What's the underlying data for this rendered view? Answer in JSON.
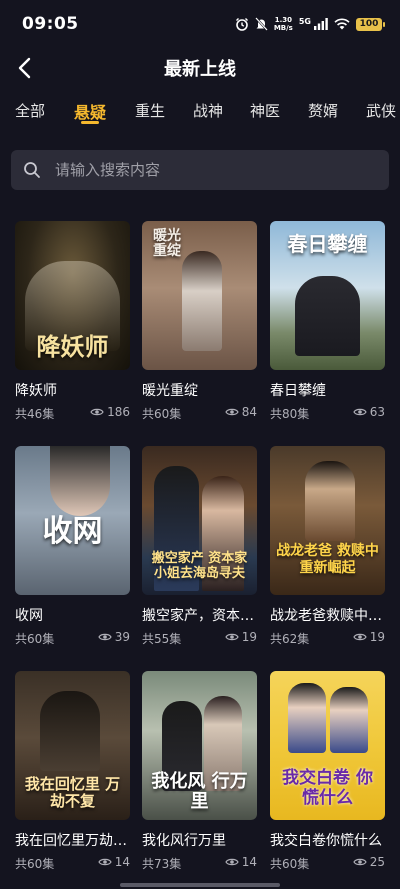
{
  "status": {
    "time": "09:05",
    "net_speed_value": "1.30",
    "net_speed_unit": "MB/s",
    "network": "5G",
    "battery": "100"
  },
  "header": {
    "title": "最新上线"
  },
  "tabs": [
    {
      "label": "全部",
      "active": false
    },
    {
      "label": "悬疑",
      "active": true
    },
    {
      "label": "重生",
      "active": false
    },
    {
      "label": "战神",
      "active": false
    },
    {
      "label": "神医",
      "active": false
    },
    {
      "label": "赘婿",
      "active": false
    },
    {
      "label": "武侠",
      "active": false
    }
  ],
  "search": {
    "placeholder": "请输入搜索内容"
  },
  "colors": {
    "accent": "#f5b82e",
    "background": "#14141f",
    "search_bg": "#2c2c38"
  },
  "cards": [
    {
      "title": "降妖师",
      "episodes": "共46集",
      "views": "186",
      "poster_text": "降妖师"
    },
    {
      "title": "暖光重绽",
      "episodes": "共60集",
      "views": "84",
      "poster_text": "暖光重绽"
    },
    {
      "title": "春日攀缠",
      "episodes": "共80集",
      "views": "63",
      "poster_text": "春日攀缠"
    },
    {
      "title": "收网",
      "episodes": "共60集",
      "views": "39",
      "poster_text": "收网"
    },
    {
      "title": "搬空家产，资本家小姐去海岛寻夫",
      "episodes": "共55集",
      "views": "19",
      "poster_text": "搬空家产 资本家小姐去海岛寻夫"
    },
    {
      "title": "战龙老爸救赎中重新崛起",
      "episodes": "共62集",
      "views": "19",
      "poster_text": "战龙老爸 救赎中重新崛起"
    },
    {
      "title": "我在回忆里万劫不复",
      "episodes": "共60集",
      "views": "14",
      "poster_text": "我在回忆里 万劫不复"
    },
    {
      "title": "我化风行万里",
      "episodes": "共73集",
      "views": "14",
      "poster_text": "我化风 行万里"
    },
    {
      "title": "我交白卷你慌什么",
      "episodes": "共60集",
      "views": "25",
      "poster_text": "我交白卷 你慌什么"
    }
  ]
}
